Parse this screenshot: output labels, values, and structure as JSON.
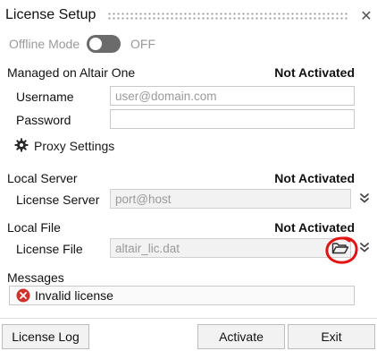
{
  "window": {
    "title": "License Setup",
    "close_glyph": "✕"
  },
  "offline": {
    "label": "Offline Mode",
    "state": "OFF",
    "enabled": false
  },
  "altair_one": {
    "heading": "Managed on Altair One",
    "status": "Not Activated",
    "username_label": "Username",
    "username_placeholder": "user@domain.com",
    "username_value": "",
    "password_label": "Password",
    "password_value": ""
  },
  "proxy": {
    "label": "Proxy Settings",
    "icon": "gear-icon"
  },
  "local_server": {
    "heading": "Local Server",
    "status": "Not Activated",
    "field_label": "License Server",
    "placeholder": "port@host"
  },
  "local_file": {
    "heading": "Local File",
    "status": "Not Activated",
    "field_label": "License File",
    "placeholder": "altair_lic.dat",
    "browse_icon": "folder-open-icon"
  },
  "messages": {
    "heading": "Messages",
    "items": [
      {
        "icon": "error-icon",
        "text": "Invalid license"
      }
    ]
  },
  "footer": {
    "license_log": "License Log",
    "activate": "Activate",
    "exit": "Exit"
  },
  "colors": {
    "error": "#d0312d",
    "annotation_circle": "#e11414",
    "toggle_off": "#6b6b6b"
  }
}
